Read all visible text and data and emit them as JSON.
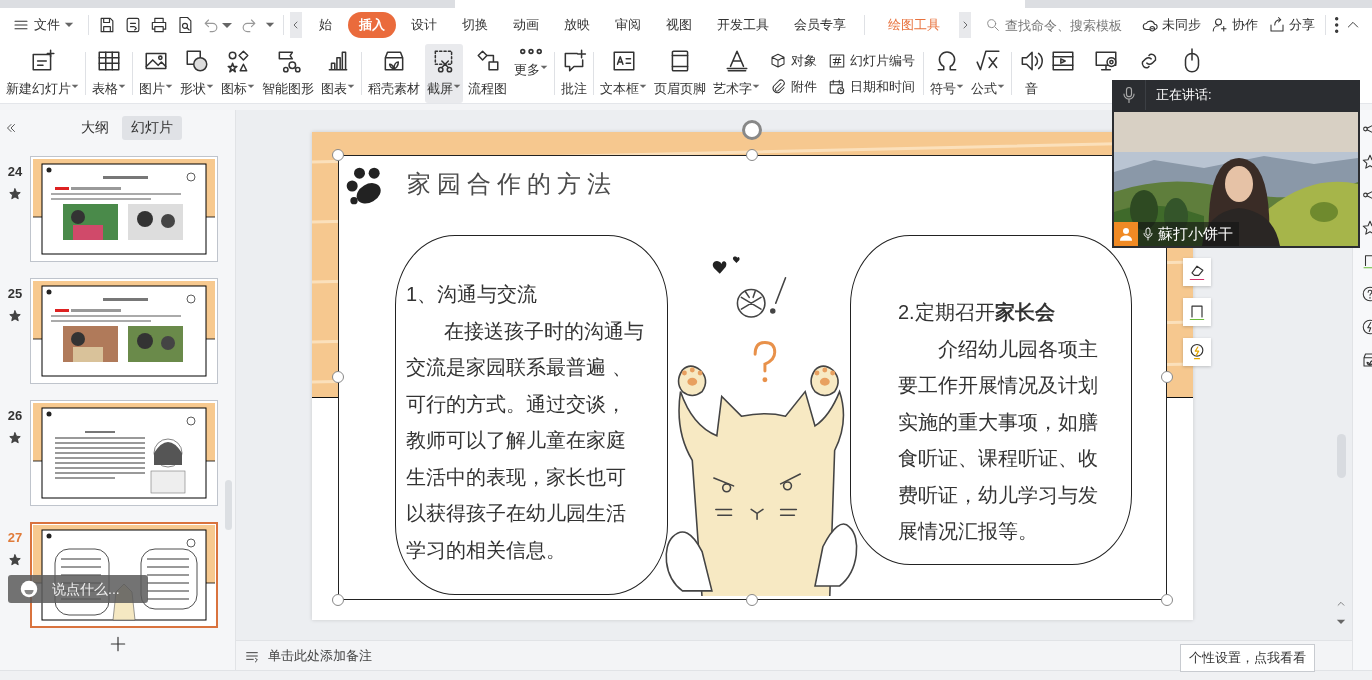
{
  "menu_bar": {
    "file_menu": "文件",
    "tabs": [
      {
        "label": "始",
        "selected": false,
        "kind": "tab"
      },
      {
        "label": "插入",
        "selected": true,
        "kind": "tab"
      },
      {
        "label": "设计",
        "selected": false,
        "kind": "tab"
      },
      {
        "label": "切换",
        "selected": false,
        "kind": "tab"
      },
      {
        "label": "动画",
        "selected": false,
        "kind": "tab"
      },
      {
        "label": "放映",
        "selected": false,
        "kind": "tab"
      },
      {
        "label": "审阅",
        "selected": false,
        "kind": "tab"
      },
      {
        "label": "视图",
        "selected": false,
        "kind": "tab"
      },
      {
        "label": "开发工具",
        "selected": false,
        "kind": "tab"
      },
      {
        "label": "会员专享",
        "selected": false,
        "kind": "tab"
      },
      {
        "label": "绘图工具",
        "selected": false,
        "kind": "context"
      }
    ],
    "search": {
      "placeholder": "查找命令、搜索模板"
    },
    "actions": [
      {
        "label": "未同步"
      },
      {
        "label": "协作"
      },
      {
        "label": "分享"
      }
    ]
  },
  "ribbon": {
    "groups": [
      {
        "items": [
          {
            "label": "新建幻灯片",
            "kind": "large",
            "dropdown": true,
            "highlighted": false
          }
        ]
      },
      {
        "items": [
          {
            "label": "表格",
            "kind": "large",
            "dropdown": true,
            "highlighted": false
          }
        ]
      },
      {
        "items": [
          {
            "label": "图片",
            "kind": "large",
            "dropdown": true,
            "highlighted": false
          },
          {
            "label": "形状",
            "kind": "large",
            "dropdown": true,
            "highlighted": false
          },
          {
            "label": "图标",
            "kind": "large",
            "dropdown": true,
            "highlighted": false
          },
          {
            "label": "智能图形",
            "kind": "large",
            "dropdown": false,
            "highlighted": false
          },
          {
            "label": "图表",
            "kind": "large",
            "dropdown": true,
            "highlighted": false
          }
        ]
      },
      {
        "items": [
          {
            "label": "稻壳素材",
            "kind": "large",
            "dropdown": false,
            "highlighted": false
          },
          {
            "label": "截屏",
            "kind": "large",
            "dropdown": true,
            "highlighted": true
          },
          {
            "label": "流程图",
            "kind": "large",
            "dropdown": false,
            "highlighted": false
          },
          {
            "label": "更多",
            "kind": "large",
            "dropdown": true,
            "highlighted": false
          }
        ]
      },
      {
        "items": [
          {
            "label": "批注",
            "kind": "large",
            "dropdown": false,
            "highlighted": false
          }
        ]
      },
      {
        "items": [
          {
            "label": "文本框",
            "kind": "large",
            "dropdown": true,
            "highlighted": false
          },
          {
            "label": "页眉页脚",
            "kind": "large",
            "dropdown": false,
            "highlighted": false
          },
          {
            "label": "艺术字",
            "kind": "large",
            "dropdown": true,
            "highlighted": false
          },
          {
            "label": "对象",
            "kind": "small",
            "dropdown": false,
            "highlighted": false
          },
          {
            "label": "附件",
            "kind": "small",
            "dropdown": false,
            "highlighted": false
          },
          {
            "label": "幻灯片编号",
            "kind": "small",
            "dropdown": false,
            "highlighted": false
          },
          {
            "label": "日期和时间",
            "kind": "small",
            "dropdown": false,
            "highlighted": false
          }
        ]
      },
      {
        "items": [
          {
            "label": "符号",
            "kind": "large",
            "dropdown": true,
            "highlighted": false
          },
          {
            "label": "公式",
            "kind": "large",
            "dropdown": true,
            "highlighted": false
          }
        ]
      },
      {
        "items": [
          {
            "label": "音",
            "kind": "large",
            "dropdown": false,
            "highlighted": false
          }
        ]
      }
    ]
  },
  "slide_panel": {
    "tabs": [
      {
        "label": "大纲",
        "selected": false
      },
      {
        "label": "幻灯片",
        "selected": true
      }
    ],
    "slides": [
      {
        "number": "24",
        "selected": false
      },
      {
        "number": "25",
        "selected": false
      },
      {
        "number": "26",
        "selected": false
      },
      {
        "number": "27",
        "selected": true
      }
    ]
  },
  "chat_input": {
    "placeholder": "说点什么..."
  },
  "slide": {
    "title": "家园合作的方法",
    "left_bubble": {
      "heading": "1、沟通与交流",
      "body": "在接送孩子时的沟通与交流是家园联系最普遍 、可行的方式。通过交谈，教师可以了解儿童在家庭生活中的表现，家长也可以获得孩子在幼儿园生活学习的相关信息。"
    },
    "right_bubble": {
      "heading": "2.定期召开**家长会**",
      "body": "介绍幼儿园各项主要工作开展情况及计划实施的重大事项，如膳食听证、课程听证、收费听证，幼儿学习与发展情况汇报等。"
    }
  },
  "notes": {
    "prompt": "单击此处添加备注"
  },
  "video_call": {
    "speaking_label": "正在讲话:",
    "participant": "蘇打小饼干"
  },
  "tooltip": "个性设置，点我看看"
}
